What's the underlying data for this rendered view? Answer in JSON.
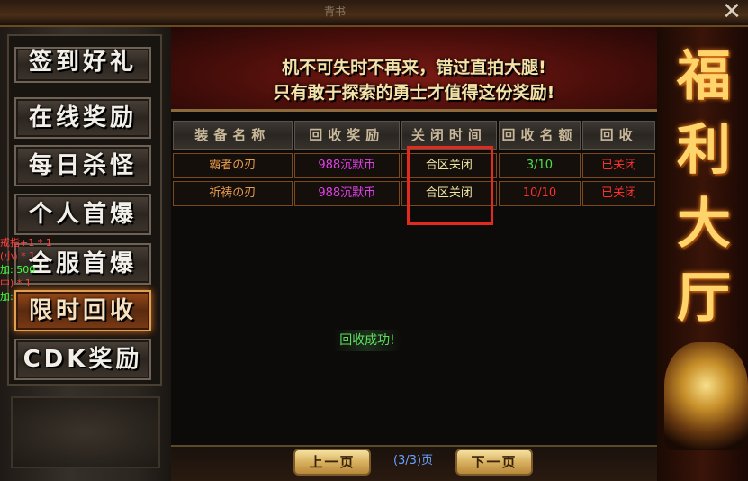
{
  "top_bar": {
    "title_fragment": "背书",
    "close_glyph": "✕"
  },
  "sidebar": {
    "items": [
      {
        "label": "签到好礼",
        "active": false
      },
      {
        "label": "在线奖励",
        "active": false
      },
      {
        "label": "每日杀怪",
        "active": false
      },
      {
        "label": "个人首爆",
        "active": false
      },
      {
        "label": "全服首爆",
        "active": false
      },
      {
        "label": "限时回收",
        "active": true
      },
      {
        "label": "CDK奖励",
        "active": false
      }
    ]
  },
  "chat_log": [
    {
      "text": "戒指+1 * 1",
      "color": "#ff4040"
    },
    {
      "text": "(小) * 1",
      "color": "#ff4040"
    },
    {
      "text": "加: 500",
      "color": "#40ff40"
    },
    {
      "text": "中) * 1",
      "color": "#ff4040"
    },
    {
      "text": "加:",
      "color": "#40ff40"
    }
  ],
  "banner": {
    "line1": "机不可失时不再来，错过直拍大腿!",
    "line2": "只有敢于探索的勇士才值得这份奖励!"
  },
  "side_title": "福利大厅",
  "table": {
    "headers": [
      "装备名称",
      "回收奖励",
      "关闭时间",
      "回收名额",
      "回收"
    ],
    "rows": [
      {
        "name": "霸者の刃",
        "reward": "988沉默币",
        "close_time": "合区关闭",
        "quota": "3/10",
        "quota_full": false,
        "state": "已关闭"
      },
      {
        "name": "祈祷の刃",
        "reward": "988沉默币",
        "close_time": "合区关闭",
        "quota": "10/10",
        "quota_full": true,
        "state": "已关闭"
      }
    ]
  },
  "toast": "回收成功!",
  "pager": {
    "prev_label": "上一页",
    "next_label": "下一页",
    "page_info": "(3/3)页"
  }
}
